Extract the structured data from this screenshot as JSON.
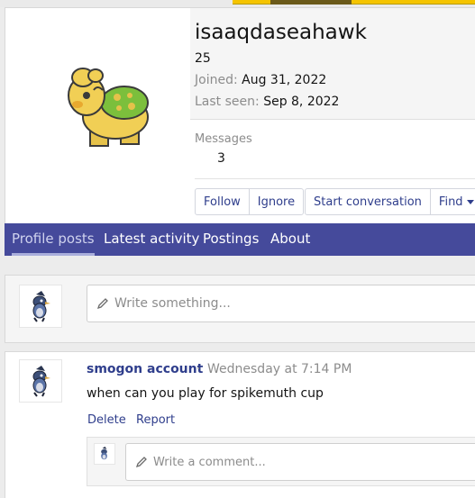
{
  "profile": {
    "username": "isaaqdaseahawk",
    "title": "25",
    "joined_label": "Joined:",
    "joined_value": "Aug 31, 2022",
    "last_seen_label": "Last seen:",
    "last_seen_value": "Sep 8, 2022",
    "messages_label": "Messages",
    "messages_value": "3"
  },
  "actions": {
    "follow": "Follow",
    "ignore": "Ignore",
    "start_conversation": "Start conversation",
    "find": "Find"
  },
  "tabs": [
    {
      "label": "Profile posts",
      "active": true
    },
    {
      "label": "Latest activity",
      "active": false
    },
    {
      "label": "Postings",
      "active": false
    },
    {
      "label": "About",
      "active": false
    }
  ],
  "compose": {
    "placeholder": "Write something..."
  },
  "post": {
    "author": "smogon account",
    "separator": "·",
    "time": "Wednesday at 7:14 PM",
    "text": "when can you play for spikemuth cup",
    "delete_label": "Delete",
    "report_label": "Report",
    "comment_placeholder": "Write a comment..."
  },
  "colors": {
    "accent": "#454a9b",
    "link": "#2f3e8c",
    "muted": "#8c8c8c"
  },
  "icons": {
    "avatar": "numel-sprite",
    "small_avatar": "bird-sprite",
    "compose": "pencil-icon",
    "find_menu": "caret-down-icon"
  }
}
